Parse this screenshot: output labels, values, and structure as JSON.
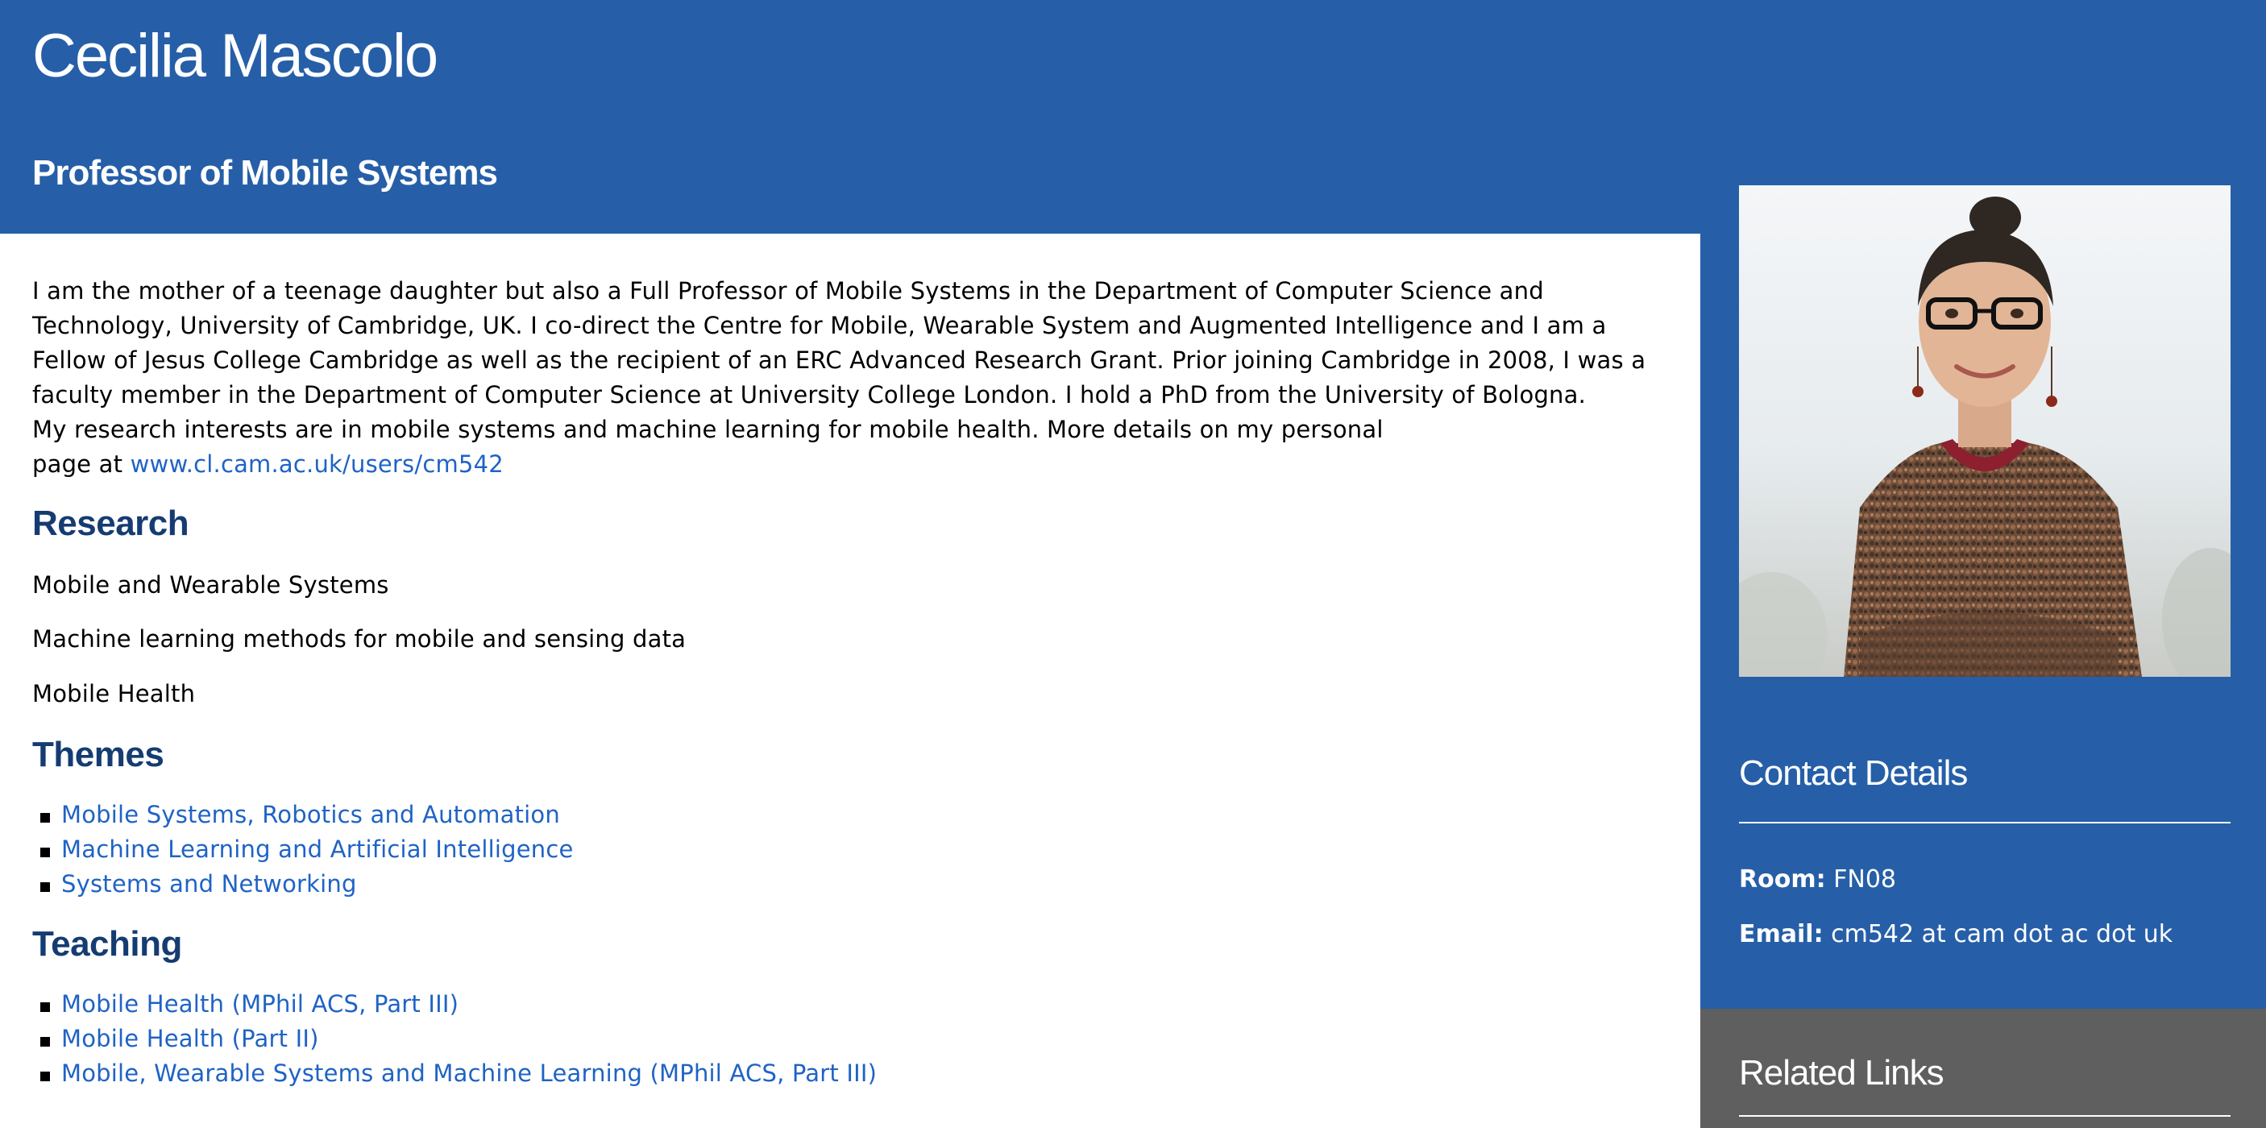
{
  "header": {
    "name": "Cecilia Mascolo",
    "title": "Professor of Mobile Systems"
  },
  "bio": {
    "line1": "I am the mother of a teenage daughter but also a Full Professor of Mobile Systems in the Department of Computer Science and",
    "line2": "Technology, University of Cambridge, UK. I co-direct the Centre for Mobile, Wearable System and Augmented Intelligence and I am a",
    "line3": "Fellow of Jesus College Cambridge as well as the recipient of an ERC Advanced Research Grant. Prior joining Cambridge in 2008, I was a",
    "line4": "faculty member in the Department of Computer Science at University College London. I hold a PhD from the University of Bologna.",
    "line5": "My research interests are in mobile systems and machine learning for mobile health.  More details on my personal",
    "line6_prefix": "page at ",
    "personal_page_link": "www.cl.cam.ac.uk/users/cm542"
  },
  "research": {
    "heading": "Research",
    "items": [
      "Mobile and Wearable Systems",
      "Machine learning methods for mobile and sensing data",
      "Mobile Health"
    ]
  },
  "themes": {
    "heading": "Themes",
    "items": [
      "Mobile Systems, Robotics and Automation",
      "Machine Learning and Artificial Intelligence",
      "Systems and Networking"
    ]
  },
  "teaching": {
    "heading": "Teaching",
    "items": [
      "Mobile Health (MPhil ACS, Part III)",
      "Mobile Health (Part II)",
      "Mobile, Wearable Systems and Machine Learning (MPhil ACS, Part III)"
    ]
  },
  "sidebar": {
    "contact_heading": "Contact Details",
    "room_label": "Room:",
    "room_value": "FN08",
    "email_label": "Email:",
    "email_value": "cm542 at cam dot ac dot uk",
    "related_heading": "Related Links"
  },
  "colors": {
    "brand_blue": "#265fa8",
    "heading_navy": "#153c72",
    "link_blue": "#1f63c4",
    "related_gray": "#5f5f5f"
  }
}
